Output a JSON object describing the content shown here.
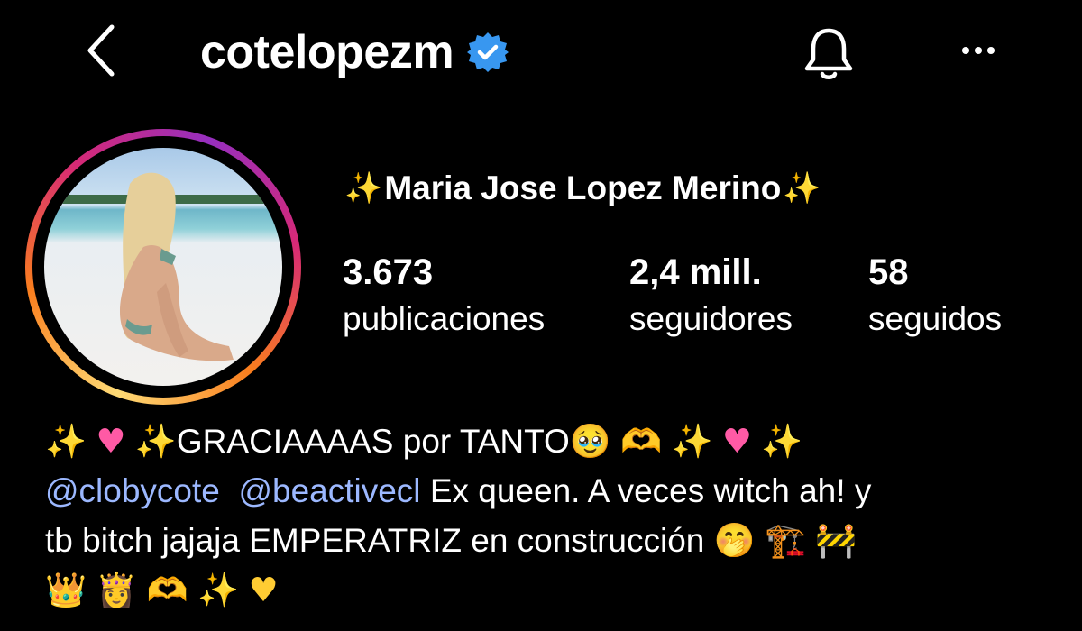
{
  "header": {
    "username": "cotelopezm"
  },
  "profile": {
    "full_name": "Maria Jose Lopez Merino",
    "stats": [
      {
        "value": "3.673",
        "label": "publicaciones"
      },
      {
        "value": "2,4 mill.",
        "label": "seguidores"
      },
      {
        "value": "58",
        "label": "seguidos"
      }
    ]
  },
  "bio": {
    "line1_text": "GRACIAAAAS por TANTO",
    "mentions": [
      "@clobycote",
      "@beactivecl"
    ],
    "line2_text": "Ex queen. A veces witch ah! y",
    "line3_text": "tb bitch jajaja EMPERATRIZ en construcción"
  },
  "icons": {
    "back": "chevron-left-icon",
    "verified": "verified-badge-icon",
    "bell": "bell-icon",
    "more": "more-horizontal-icon"
  },
  "colors": {
    "background": "#000000",
    "verified_blue": "#3897f0",
    "mention": "#9cb8ff"
  }
}
